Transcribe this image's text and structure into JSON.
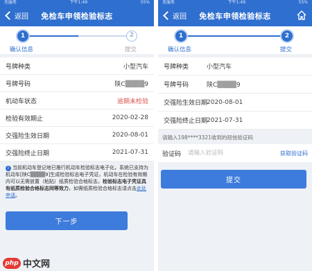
{
  "colors": {
    "primary": "#2f6fcf",
    "alert": "#d9534f",
    "link": "#2f6fcf"
  },
  "screen1": {
    "status": {
      "left": "无服务",
      "center": "下午1:49",
      "right": "55%"
    },
    "nav": {
      "back_label": "返回",
      "title": "免检车申领检验标志"
    },
    "steps": [
      {
        "number": "1",
        "label": "确认信息"
      },
      {
        "number": "2",
        "label": "提交"
      }
    ],
    "rows": [
      {
        "label": "号牌种类",
        "value": "小型汽车"
      },
      {
        "label": "号牌号码",
        "value": "陕C▒▒▒▒9"
      },
      {
        "label": "机动车状态",
        "value": "逾期未检验"
      },
      {
        "label": "检验有效期止",
        "value": "2020-02-28"
      },
      {
        "label": "交强险生效日期",
        "value": "2020-08-01"
      },
      {
        "label": "交强险终止日期",
        "value": "2021-07-31"
      }
    ],
    "notice": {
      "part1": "当前机动车登记地已推行机动车检验标志电子化，系统已支持为机动车[陕C▒▒▒▒9]生成检验标志电子凭证，机动车在检验有效期内可以无需放置（粘贴）纸质检验合格标志，",
      "bold": "检验标志电子凭证具有纸质检验合格标志同等效力",
      "part2": "，如需纸质检验合格标志请点击",
      "link": "此处申请",
      "end": "。"
    },
    "next_button": "下一步"
  },
  "screen2": {
    "status": {
      "left": "无服务",
      "center": "下午1:49",
      "right": "55%"
    },
    "nav": {
      "back_label": "返回",
      "title": "免检车申领检验标志"
    },
    "steps": [
      {
        "number": "1",
        "label": "确认信息"
      },
      {
        "number": "2",
        "label": "提交"
      }
    ],
    "rows": [
      {
        "label": "号牌种类",
        "value": "小型汽车"
      },
      {
        "label": "号牌号码",
        "value": "陕C▒▒▒▒9"
      },
      {
        "label": "交强险生效日期",
        "value": "2020-08-01"
      },
      {
        "label": "交强险终止日期",
        "value": "2021-07-31"
      }
    ],
    "sms_info": "请输入198****3321收到的短信验证码",
    "code": {
      "label": "验证码",
      "placeholder": "请输入验证码",
      "get_code": "获取验证码"
    },
    "submit_button": "提交"
  },
  "watermark": {
    "logo": "php",
    "text": "中文网"
  }
}
